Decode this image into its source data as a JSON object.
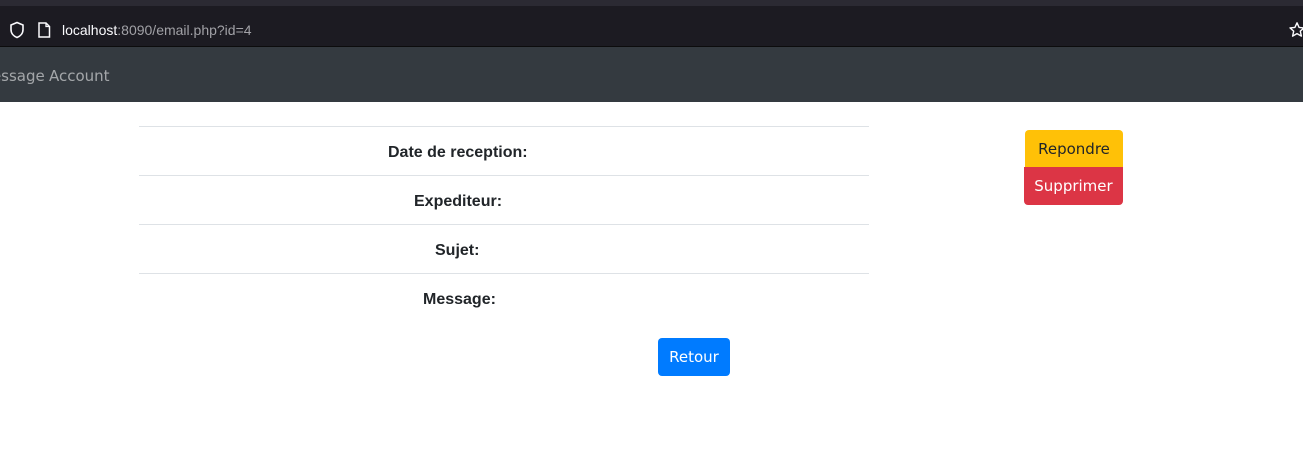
{
  "browser": {
    "url_host": "localhost",
    "url_rest": ":8090/email.php?id=4"
  },
  "navbar": {
    "items": [
      {
        "label": "Message"
      },
      {
        "label": "Account"
      }
    ]
  },
  "email": {
    "fields": [
      {
        "label": "Date de reception:"
      },
      {
        "label": "Expediteur:"
      },
      {
        "label": "Sujet:"
      },
      {
        "label": "Message:"
      }
    ],
    "back_label": "Retour"
  },
  "actions": {
    "reply_label": "Repondre",
    "delete_label": "Supprimer"
  },
  "colors": {
    "navbar_bg": "#343a40",
    "primary": "#007bff",
    "warning": "#ffc107",
    "danger": "#dc3545"
  }
}
